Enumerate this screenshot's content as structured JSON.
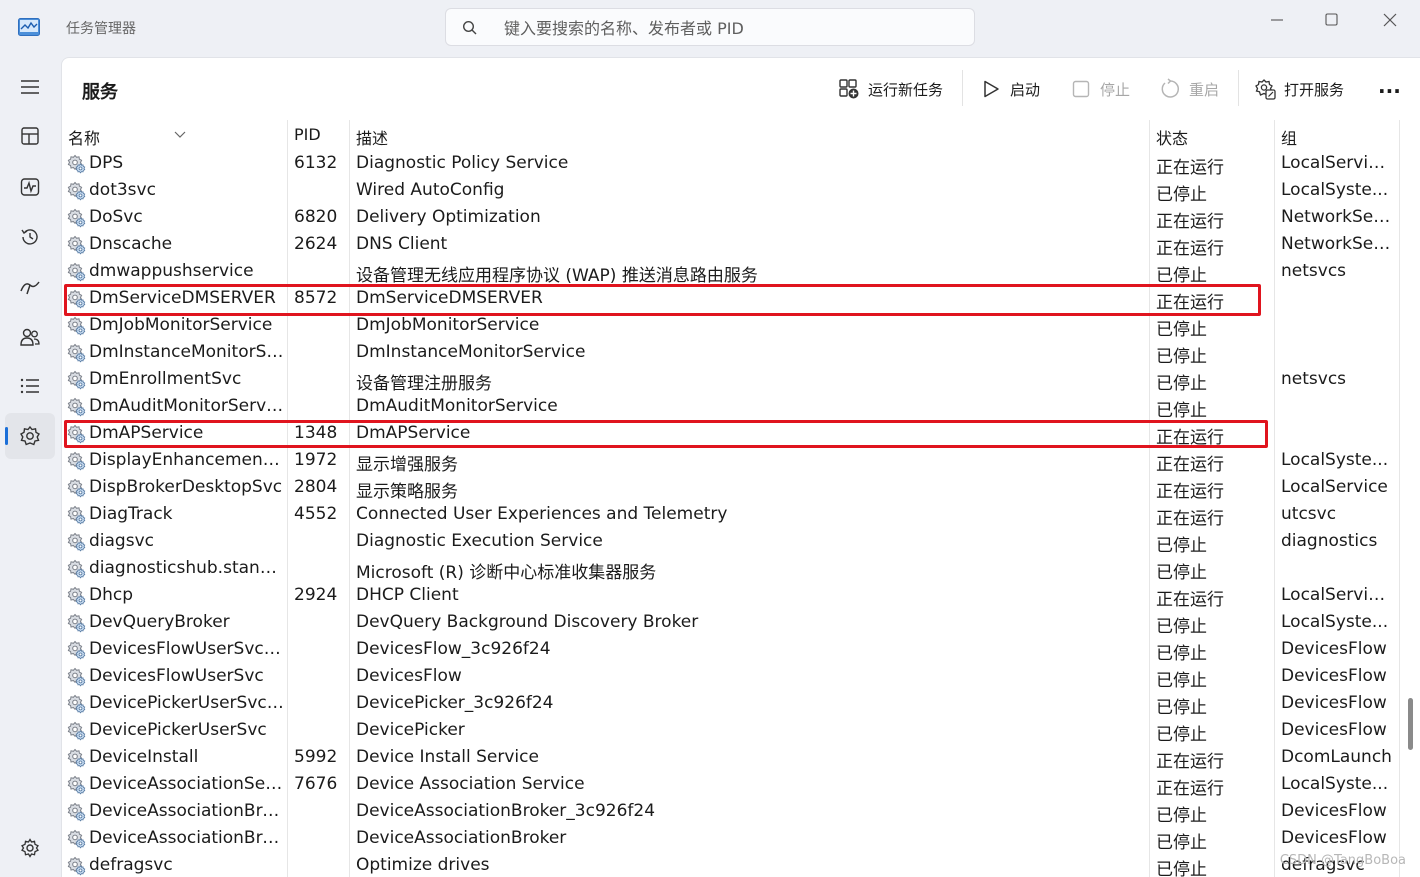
{
  "app": {
    "title": "任务管理器",
    "search_placeholder": "键入要搜索的名称、发布者或 PID"
  },
  "page": {
    "title": "服务"
  },
  "toolbar": {
    "run_new_task": "运行新任务",
    "start": "启动",
    "stop": "停止",
    "restart": "重启",
    "open_services": "打开服务",
    "more": "..."
  },
  "nav": {
    "items": [
      "menu-icon",
      "processes-icon",
      "performance-icon",
      "app-history-icon",
      "startup-apps-icon",
      "users-icon",
      "details-icon",
      "services-icon"
    ],
    "active": "services-icon",
    "settings": "settings-icon"
  },
  "table": {
    "columns": {
      "name": "名称",
      "pid": "PID",
      "description": "描述",
      "status": "状态",
      "group": "组"
    },
    "rows": [
      {
        "name": "DPS",
        "pid": "6132",
        "description": "Diagnostic Policy Service",
        "status": "正在运行",
        "group": "LocalServic..."
      },
      {
        "name": "dot3svc",
        "pid": "",
        "description": "Wired AutoConfig",
        "status": "已停止",
        "group": "LocalSyste..."
      },
      {
        "name": "DoSvc",
        "pid": "6820",
        "description": "Delivery Optimization",
        "status": "正在运行",
        "group": "NetworkSer..."
      },
      {
        "name": "Dnscache",
        "pid": "2624",
        "description": "DNS Client",
        "status": "正在运行",
        "group": "NetworkSer..."
      },
      {
        "name": "dmwappushservice",
        "pid": "",
        "description": "设备管理无线应用程序协议 (WAP) 推送消息路由服务",
        "status": "已停止",
        "group": "netsvcs"
      },
      {
        "name": "DmServiceDMSERVER",
        "pid": "8572",
        "description": "DmServiceDMSERVER",
        "status": "正在运行",
        "group": "",
        "highlighted": true
      },
      {
        "name": "DmJobMonitorService",
        "pid": "",
        "description": "DmJobMonitorService",
        "status": "已停止",
        "group": ""
      },
      {
        "name": "DmInstanceMonitorSe...",
        "pid": "",
        "description": "DmInstanceMonitorService",
        "status": "已停止",
        "group": ""
      },
      {
        "name": "DmEnrollmentSvc",
        "pid": "",
        "description": "设备管理注册服务",
        "status": "已停止",
        "group": "netsvcs"
      },
      {
        "name": "DmAuditMonitorServi...",
        "pid": "",
        "description": "DmAuditMonitorService",
        "status": "已停止",
        "group": ""
      },
      {
        "name": "DmAPService",
        "pid": "1348",
        "description": "DmAPService",
        "status": "正在运行",
        "group": "",
        "highlighted": true
      },
      {
        "name": "DisplayEnhancementS...",
        "pid": "1972",
        "description": "显示增强服务",
        "status": "正在运行",
        "group": "LocalSyste..."
      },
      {
        "name": "DispBrokerDesktopSvc",
        "pid": "2804",
        "description": "显示策略服务",
        "status": "正在运行",
        "group": "LocalService"
      },
      {
        "name": "DiagTrack",
        "pid": "4552",
        "description": "Connected User Experiences and Telemetry",
        "status": "正在运行",
        "group": "utcsvc"
      },
      {
        "name": "diagsvc",
        "pid": "",
        "description": "Diagnostic Execution Service",
        "status": "已停止",
        "group": "diagnostics"
      },
      {
        "name": "diagnosticshub.standa...",
        "pid": "",
        "description": "Microsoft (R) 诊断中心标准收集器服务",
        "status": "已停止",
        "group": ""
      },
      {
        "name": "Dhcp",
        "pid": "2924",
        "description": "DHCP Client",
        "status": "正在运行",
        "group": "LocalServic..."
      },
      {
        "name": "DevQueryBroker",
        "pid": "",
        "description": "DevQuery Background Discovery Broker",
        "status": "已停止",
        "group": "LocalSyste..."
      },
      {
        "name": "DevicesFlowUserSvc_...",
        "pid": "",
        "description": "DevicesFlow_3c926f24",
        "status": "已停止",
        "group": "DevicesFlow"
      },
      {
        "name": "DevicesFlowUserSvc",
        "pid": "",
        "description": "DevicesFlow",
        "status": "已停止",
        "group": "DevicesFlow"
      },
      {
        "name": "DevicePickerUserSvc_...",
        "pid": "",
        "description": "DevicePicker_3c926f24",
        "status": "已停止",
        "group": "DevicesFlow"
      },
      {
        "name": "DevicePickerUserSvc",
        "pid": "",
        "description": "DevicePicker",
        "status": "已停止",
        "group": "DevicesFlow"
      },
      {
        "name": "DeviceInstall",
        "pid": "5992",
        "description": "Device Install Service",
        "status": "正在运行",
        "group": "DcomLaunch"
      },
      {
        "name": "DeviceAssociationSer...",
        "pid": "7676",
        "description": "Device Association Service",
        "status": "正在运行",
        "group": "LocalSyste..."
      },
      {
        "name": "DeviceAssociationBro...",
        "pid": "",
        "description": "DeviceAssociationBroker_3c926f24",
        "status": "已停止",
        "group": "DevicesFlow"
      },
      {
        "name": "DeviceAssociationBro...",
        "pid": "",
        "description": "DeviceAssociationBroker",
        "status": "已停止",
        "group": "DevicesFlow"
      },
      {
        "name": "defragsvc",
        "pid": "",
        "description": "Optimize drives",
        "status": "已停止",
        "group": "defragsvc"
      }
    ]
  },
  "watermark": "CSDN @TangBoBoa"
}
